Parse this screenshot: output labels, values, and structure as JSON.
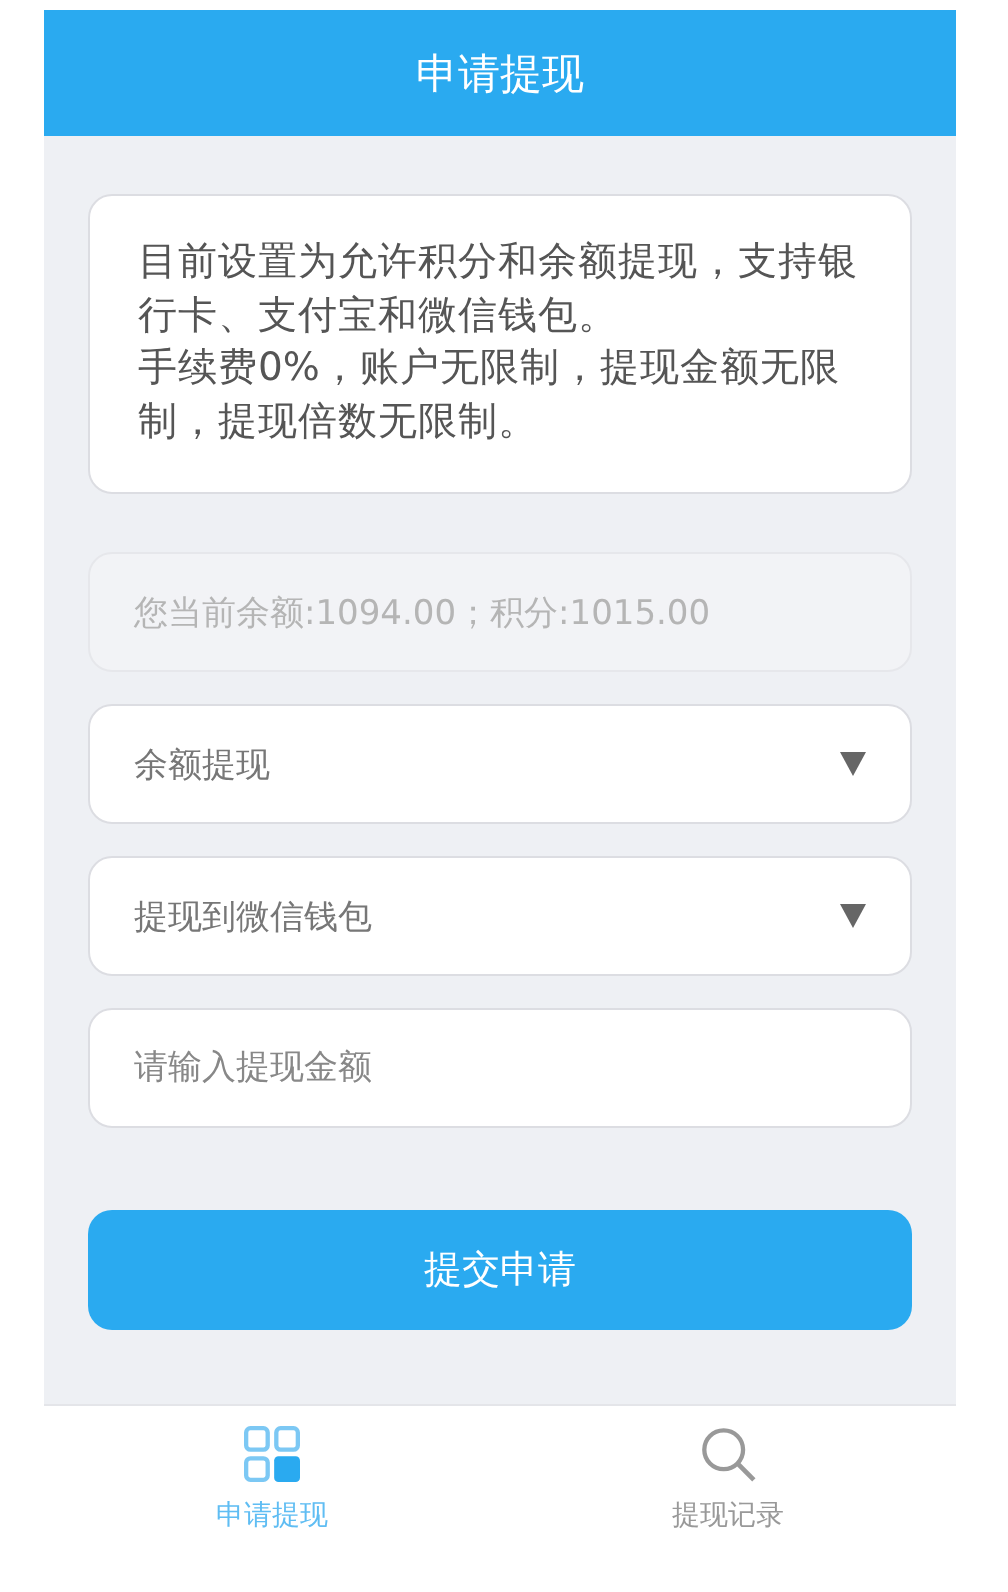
{
  "header": {
    "title": "申请提现"
  },
  "notice": [
    "目前设置为允许积分和余额提现，支持银行卡、支付宝和微信钱包。",
    "手续费0%，账户无限制，提现金额无限制，提现倍数无限制。"
  ],
  "fields": [
    {
      "kind": "readonly",
      "value": "您当前余额:1094.00；积分:1015.00",
      "disabled": true
    },
    {
      "kind": "select",
      "value": "余额提现"
    },
    {
      "kind": "select",
      "value": "提现到微信钱包"
    },
    {
      "kind": "input",
      "placeholder": "请输入提现金额"
    }
  ],
  "submit": {
    "label": "提交申请"
  },
  "tabbar": [
    {
      "label": "申请提现",
      "kind": "grid",
      "selected": true
    },
    {
      "label": "提现记录",
      "kind": "search",
      "selected": false
    }
  ]
}
